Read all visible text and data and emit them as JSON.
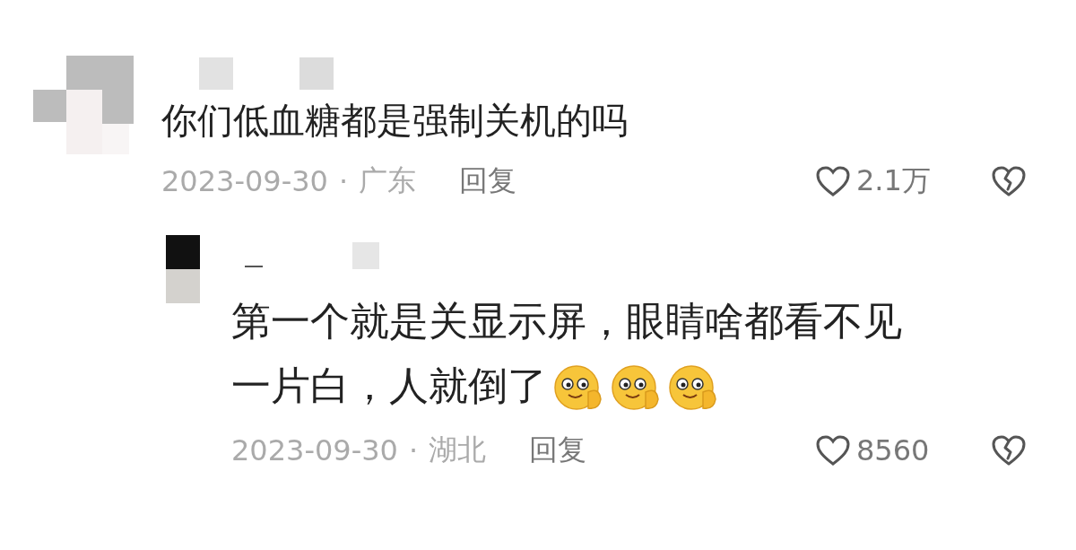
{
  "comments": [
    {
      "text": "你们低血糖都是强制关机的吗",
      "date": "2023-09-30",
      "separator": "·",
      "region": "广东",
      "reply_label": "回复",
      "likes": "2.1万",
      "liked": false,
      "disliked": false,
      "is_reply": false
    },
    {
      "text": "第一个就是关显示屏，眼睛啥都看不见一片白，人就倒了",
      "date": "2023-09-30",
      "separator": "·",
      "region": "湖北",
      "reply_label": "回复",
      "likes": "8560",
      "liked": false,
      "disliked": false,
      "is_reply": true,
      "emojis": [
        {
          "kind": "shy"
        },
        {
          "kind": "shy"
        },
        {
          "kind": "shy"
        }
      ]
    }
  ]
}
